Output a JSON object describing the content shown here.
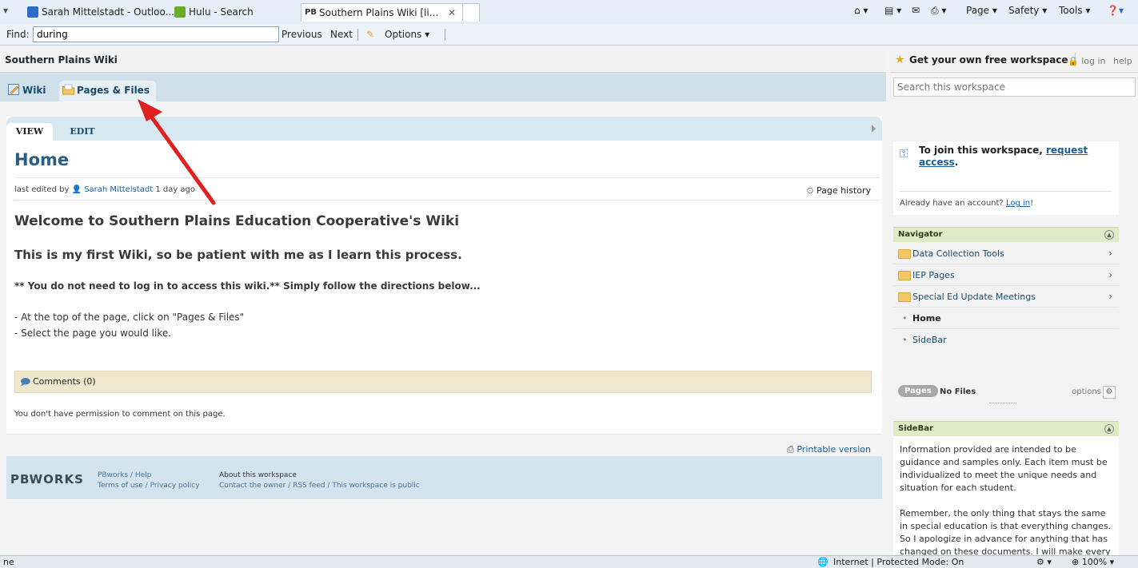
{
  "browser": {
    "tabs": [
      {
        "label": "Sarah Mittelstadt - Outloo..."
      },
      {
        "label": "Hulu - Search"
      },
      {
        "label": "Southern Plains Wiki [li..."
      }
    ],
    "commands": {
      "page": "Page ▾",
      "safety": "Safety ▾",
      "tools": "Tools ▾"
    },
    "find": {
      "label": "Find:",
      "value": "during",
      "previous": "Previous",
      "next": "Next",
      "options": "Options ▾"
    },
    "status": {
      "left": "ne",
      "zone": "Internet | Protected Mode: On",
      "zoom": "100%"
    }
  },
  "site": {
    "title": "Southern Plains Wiki"
  },
  "top_tabs": [
    {
      "label": "Wiki",
      "icon": "wiki-icon"
    },
    {
      "label": "Pages & Files",
      "icon": "folder-icon"
    }
  ],
  "view_tabs": [
    {
      "label": "VIEW"
    },
    {
      "label": "EDIT"
    }
  ],
  "page": {
    "title": "Home",
    "edited_prefix": "last edited by",
    "edited_by": "Sarah Mittelstadt",
    "edited_when": "1 day ago",
    "history": "Page history",
    "heading1": "Welcome to Southern Plains Education Cooperative's Wiki",
    "heading2": "This is my first Wiki, so be patient with me as I learn this process.",
    "heading3": "** You do not need to log in to access this wiki.** Simply follow the directions below...",
    "line1": "- At the top of the page, click on \"Pages & Files\"",
    "line2": "- Select the page you would like.",
    "comments": "Comments (0)",
    "no_permission": "You don't have permission to comment on this page.",
    "printable": "Printable version"
  },
  "footer": {
    "logo": "PBWORKS",
    "links1": "PBworks / Help",
    "links2": "Terms of use / Privacy policy",
    "about": "About this workspace",
    "about_links": "Contact the owner / RSS feed / This workspace is public"
  },
  "right": {
    "free_workspace": "Get your own free workspace",
    "login": "log in",
    "help": "help",
    "search_placeholder": "Search this workspace",
    "join_text": "To join this workspace,",
    "join_link": "request access",
    "already": "Already have an account?",
    "already_link": "Log in",
    "navigator": {
      "title": "Navigator",
      "folders": [
        {
          "label": "Data Collection Tools"
        },
        {
          "label": "IEP Pages"
        },
        {
          "label": "Special Ed Update Meetings"
        }
      ],
      "pages": [
        {
          "label": "Home"
        },
        {
          "label": "SideBar"
        }
      ],
      "pages_pill": "Pages",
      "no_files": "No Files",
      "options": "options"
    },
    "sidebar": {
      "title": "SideBar",
      "para1": "Information provided are intended to be guidance and samples only. Each item must be individualized to meet the unique needs and situation for each student.",
      "para2": "Remember, the only thing that stays the same in special education is that everything changes. So I apologize in advance for anything that has changed on these documents. I will make every"
    }
  },
  "colors": {
    "accent": "#2a5f83",
    "link": "#1a5ea0",
    "arrow": "#e02020",
    "panel_head": "#dfeac7"
  }
}
